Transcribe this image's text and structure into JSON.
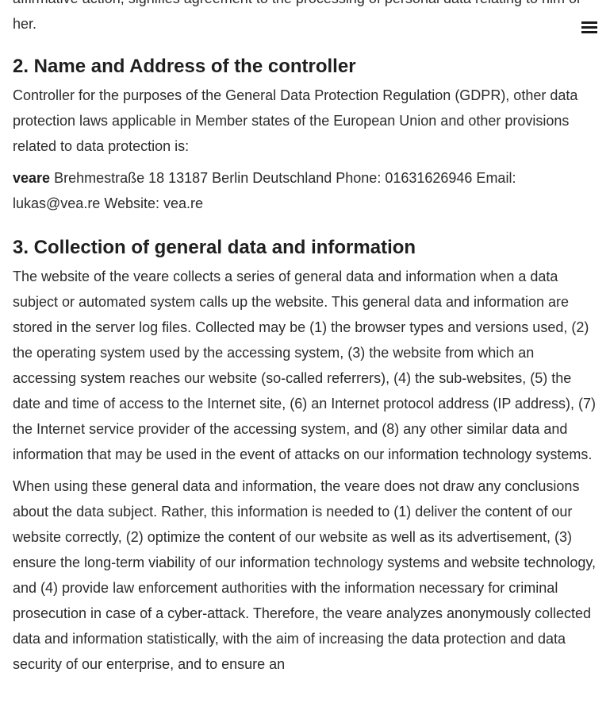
{
  "intro": {
    "tail_text": "affirmative action, signifies agreement to the processing of personal data relating to him or her."
  },
  "menu": {
    "icon": "hamburger-menu-icon"
  },
  "section2": {
    "heading": "2. Name and Address of the controller",
    "paragraph": "Controller for the purposes of the General Data Protection Regulation (GDPR), other data protection laws applicable in Member states of the European Union and other provisions related to data protection is:",
    "company_name": "veare",
    "address_text": " Brehmestraße 18 13187 Berlin Deutschland Phone: 01631626946 Email: lukas@vea.re Website: vea.re"
  },
  "section3": {
    "heading": "3. Collection of general data and information",
    "paragraph1": "The website of the veare collects a series of general data and information when a data subject or automated system calls up the website. This general data and information are stored in the server log files. Collected may be (1) the browser types and versions used, (2) the operating system used by the accessing system, (3) the website from which an accessing system reaches our website (so-called referrers), (4) the sub-websites, (5) the date and time of access to the Internet site, (6) an Internet protocol address (IP address), (7) the Internet service provider of the accessing system, and (8) any other similar data and information that may be used in the event of attacks on our information technology systems.",
    "paragraph2": "When using these general data and information, the veare does not draw any conclusions about the data subject. Rather, this information is needed to (1) deliver the content of our website correctly, (2) optimize the content of our website as well as its advertisement, (3) ensure the long-term viability of our information technology systems and website technology, and (4) provide law enforcement authorities with the information necessary for criminal prosecution in case of a cyber-attack. Therefore, the veare analyzes anonymously collected data and information statistically, with the aim of increasing the data protection and data security of our enterprise, and to ensure an"
  }
}
